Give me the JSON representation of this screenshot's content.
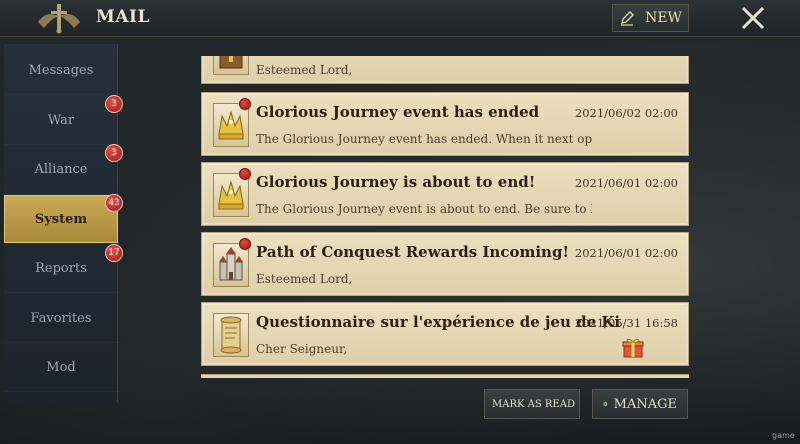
{
  "header": {
    "title": "MAIL",
    "new_label": "NEW"
  },
  "sidebar": {
    "tabs": [
      {
        "label": "Messages",
        "badge": ""
      },
      {
        "label": "War",
        "badge": "3"
      },
      {
        "label": "Alliance",
        "badge": "3"
      },
      {
        "label": "System",
        "badge": "43"
      },
      {
        "label": "Reports",
        "badge": "17"
      },
      {
        "label": "Favorites",
        "badge": ""
      },
      {
        "label": "Mod",
        "badge": ""
      }
    ],
    "active": "System"
  },
  "mails": [
    {
      "subject": "",
      "date": "",
      "preview": "Esteemed Lord,",
      "icon": "reward-chest-icon",
      "unread": false
    },
    {
      "subject": "Glorious Journey event has ended",
      "date": "2021/06/02 02:00",
      "preview": "The Glorious Journey event has ended. When it next opens yo",
      "icon": "golden-crown-icon",
      "unread": true
    },
    {
      "subject": "Glorious Journey is about to end!",
      "date": "2021/06/01 02:00",
      "preview": "The Glorious Journey event is about to end. Be sure to level u",
      "icon": "golden-crown-icon",
      "unread": true
    },
    {
      "subject": "Path of Conquest Rewards Incoming!",
      "date": "2021/06/01 02:00",
      "preview": "Esteemed Lord,",
      "icon": "castle-icon",
      "unread": true
    },
    {
      "subject": "Questionnaire sur l'expérience de jeu de Ki",
      "date": "2021/05/31 16:58",
      "preview": "Cher Seigneur,",
      "icon": "scroll-icon",
      "unread": false,
      "attachment": "gift-icon"
    }
  ],
  "footer": {
    "mark_read_label": "MARK AS READ",
    "manage_label": "MANAGE"
  },
  "watermark": "game"
}
